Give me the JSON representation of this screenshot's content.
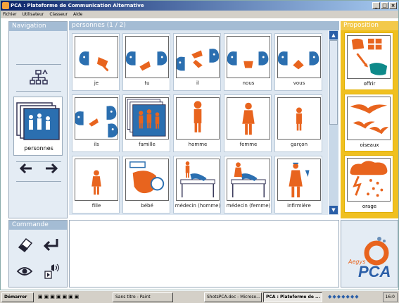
{
  "window": {
    "title": "PCA : Plateforme de Communication Alternative",
    "buttons": [
      "_",
      "□",
      "×"
    ]
  },
  "menubar": [
    "Fichier",
    "Utilisateur",
    "Classeur",
    "Aide"
  ],
  "navigation": {
    "title": "Navigation",
    "current_folder_label": "personnes"
  },
  "commande": {
    "title": "Commande"
  },
  "main": {
    "header": "personnes (1 / 2)",
    "cells": [
      {
        "label": "je",
        "icon": "je-icon"
      },
      {
        "label": "tu",
        "icon": "tu-icon"
      },
      {
        "label": "il",
        "icon": "il-icon"
      },
      {
        "label": "nous",
        "icon": "nous-icon"
      },
      {
        "label": "vous",
        "icon": "vous-icon"
      },
      {
        "label": "ils",
        "icon": "ils-icon"
      },
      {
        "label": "famille",
        "icon": "famille-icon"
      },
      {
        "label": "homme",
        "icon": "homme-icon"
      },
      {
        "label": "femme",
        "icon": "femme-icon"
      },
      {
        "label": "garçon",
        "icon": "garcon-icon"
      },
      {
        "label": "fille",
        "icon": "fille-icon"
      },
      {
        "label": "bébé",
        "icon": "bebe-icon"
      },
      {
        "label": "médecin (homme)",
        "icon": "medecin-homme-icon"
      },
      {
        "label": "médecin (femme)",
        "icon": "medecin-femme-icon"
      },
      {
        "label": "infirmière",
        "icon": "infirmiere-icon"
      }
    ]
  },
  "proposition": {
    "title": "Proposition",
    "items": [
      {
        "label": "offrir",
        "icon": "offrir-icon"
      },
      {
        "label": "oiseaux",
        "icon": "oiseaux-icon"
      },
      {
        "label": "orage",
        "icon": "orage-icon"
      }
    ]
  },
  "logo": {
    "small": "Aegys",
    "big": "PCA"
  },
  "taskbar": {
    "start": "Démarrer",
    "items": [
      "Sans titre - Paint",
      "ShotsPCA.doc - Microso...",
      "PCA : Plateforme de ..."
    ],
    "clock": "16:0"
  },
  "colors": {
    "accent": "#e8641e",
    "nav_bg": "#e4ecf4",
    "proposition": "#f0c020"
  }
}
